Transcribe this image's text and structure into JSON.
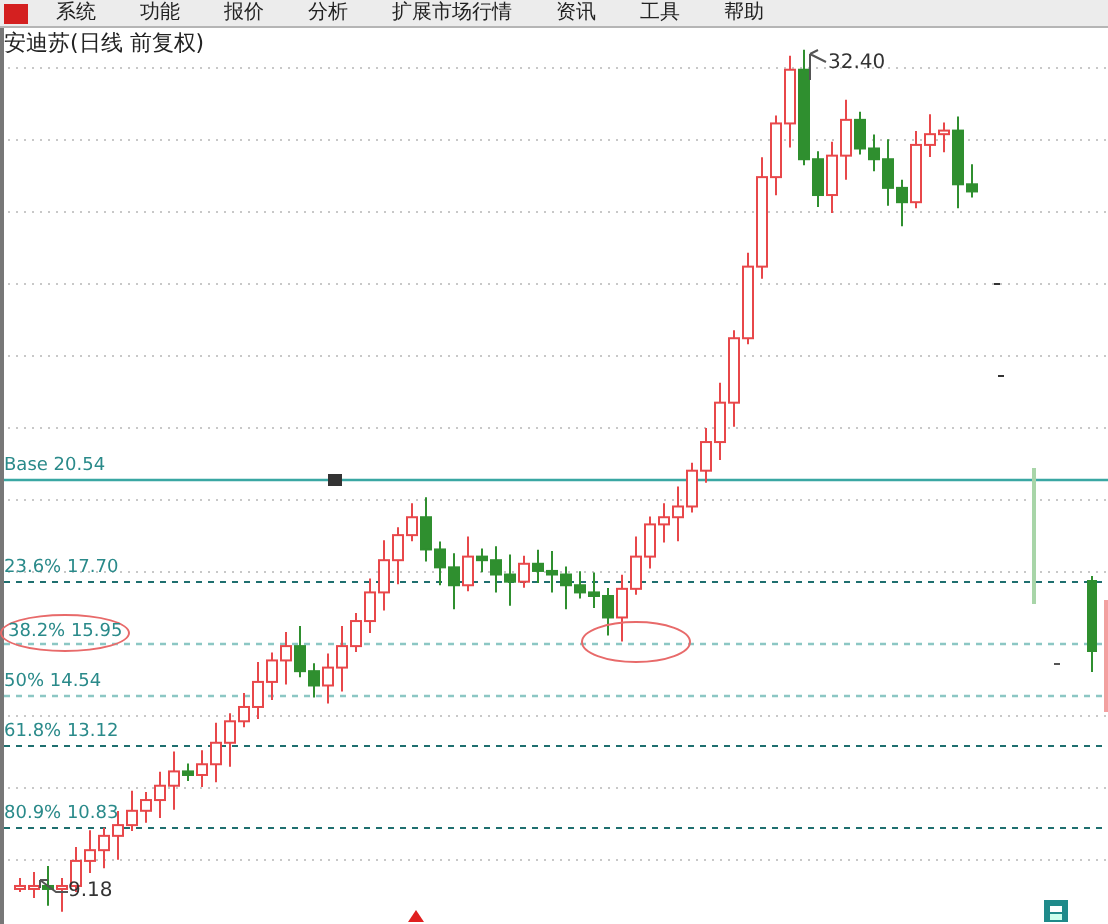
{
  "menu": [
    {
      "label": "系统"
    },
    {
      "label": "功能"
    },
    {
      "label": "报价"
    },
    {
      "label": "分析"
    },
    {
      "label": "扩展市场行情"
    },
    {
      "label": "资讯"
    },
    {
      "label": "工具"
    },
    {
      "label": "帮助"
    }
  ],
  "title": "安迪苏(日线 前复权)",
  "levels": [
    {
      "label": "Base 20.54",
      "kind": "base",
      "circled": false
    },
    {
      "label": "23.6% 17.70",
      "kind": "dashed",
      "circled": false
    },
    {
      "label": "38.2% 15.95",
      "kind": "light",
      "circled": true
    },
    {
      "label": "50% 14.54",
      "kind": "light",
      "circled": false
    },
    {
      "label": "61.8% 13.12",
      "kind": "dashed",
      "circled": false
    },
    {
      "label": "80.9% 10.83",
      "kind": "dashed",
      "circled": false
    }
  ],
  "high_label": "32.40",
  "low_label": "9.18"
}
